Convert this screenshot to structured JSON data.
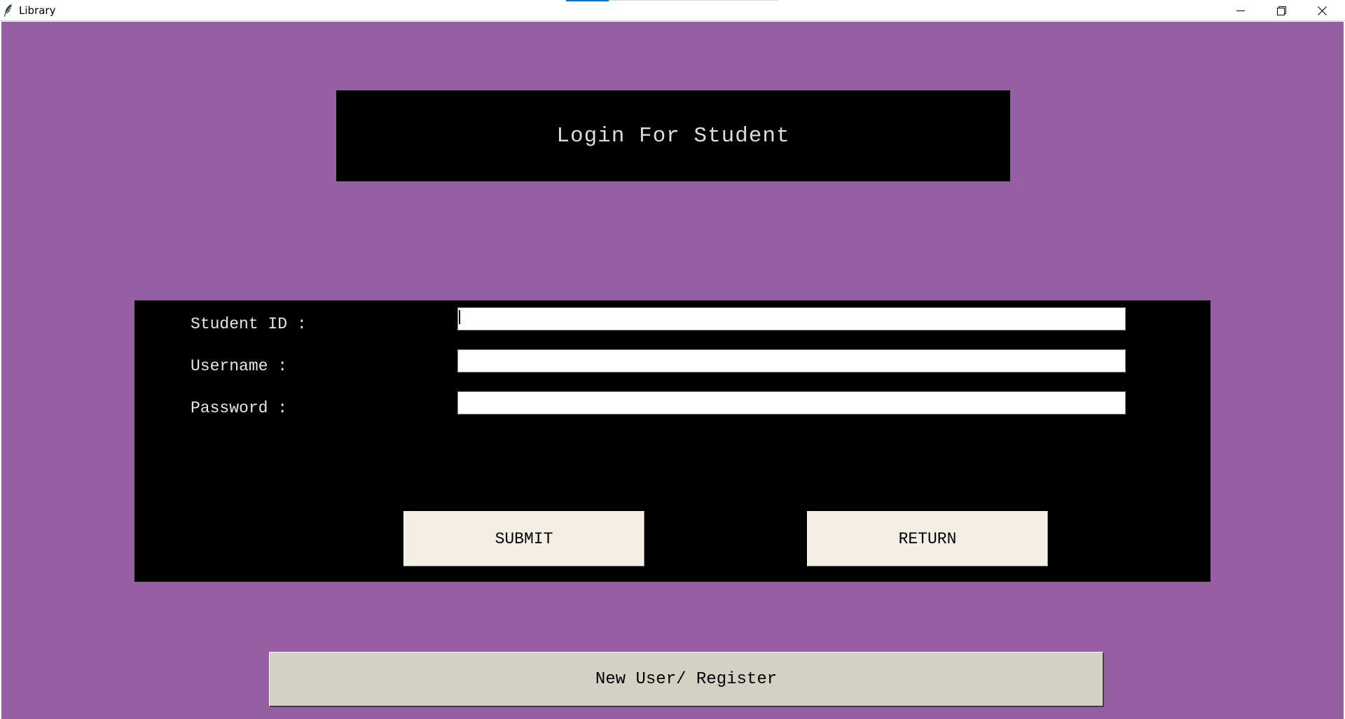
{
  "window": {
    "title": "Library",
    "icon": "feather-icon",
    "controls": {
      "minimize_icon": "minimize-icon",
      "maximize_icon": "restore-icon",
      "close_icon": "close-icon"
    }
  },
  "colors": {
    "background": "#965fa3",
    "panel": "#000000",
    "heading_text": "#dcdcdc",
    "label_text": "#e6e6e6",
    "action_button": "#f4efe2",
    "register_button": "#d4d0c4"
  },
  "heading": {
    "title": "Login For Student"
  },
  "form": {
    "fields": [
      {
        "label": "Student ID :",
        "value": "",
        "placeholder": ""
      },
      {
        "label": "Username :",
        "value": "",
        "placeholder": ""
      },
      {
        "label": "Password :",
        "value": "",
        "placeholder": ""
      }
    ],
    "submit_label": "SUBMIT",
    "return_label": "RETURN"
  },
  "register": {
    "label": "New User/ Register"
  }
}
